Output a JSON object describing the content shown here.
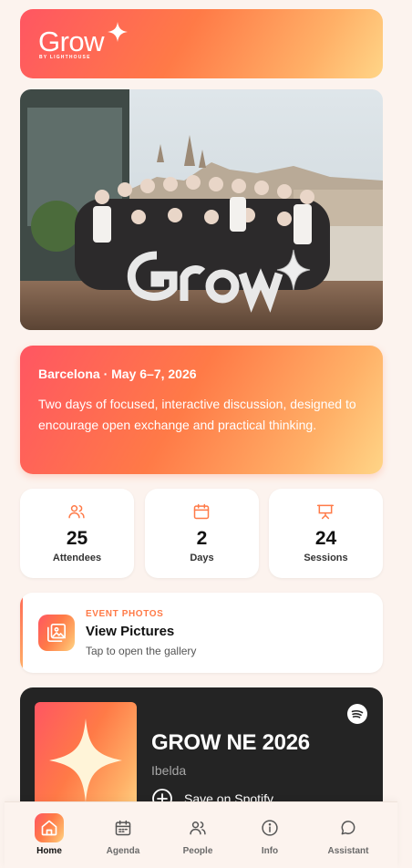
{
  "brand": {
    "logo_word": "Grow",
    "logo_sub": "BY LIGHTHOUSE"
  },
  "event": {
    "date_line": "Barcelona · May 6–7, 2026",
    "description": "Two days of focused, interactive discussion, designed to encourage open exchange and practical thinking."
  },
  "stats": [
    {
      "icon": "people-icon",
      "value": "25",
      "label": "Attendees"
    },
    {
      "icon": "calendar-icon",
      "value": "2",
      "label": "Days"
    },
    {
      "icon": "presentation-icon",
      "value": "24",
      "label": "Sessions"
    }
  ],
  "photos": {
    "eyebrow": "EVENT PHOTOS",
    "title": "View Pictures",
    "subtitle": "Tap to open the gallery",
    "icon": "gallery-icon"
  },
  "spotify": {
    "title": "GROW NE 2026",
    "artist": "Ibelda",
    "save_label": "Save on Spotify"
  },
  "nav": [
    {
      "label": "Home",
      "icon": "home-icon",
      "active": true
    },
    {
      "label": "Agenda",
      "icon": "calendar-icon"
    },
    {
      "label": "People",
      "icon": "people-icon"
    },
    {
      "label": "Info",
      "icon": "info-icon"
    },
    {
      "label": "Assistant",
      "icon": "chat-icon"
    }
  ],
  "colors": {
    "accent": "#ff7a47",
    "background": "#fcf3ee",
    "spotify_card": "#242424"
  }
}
